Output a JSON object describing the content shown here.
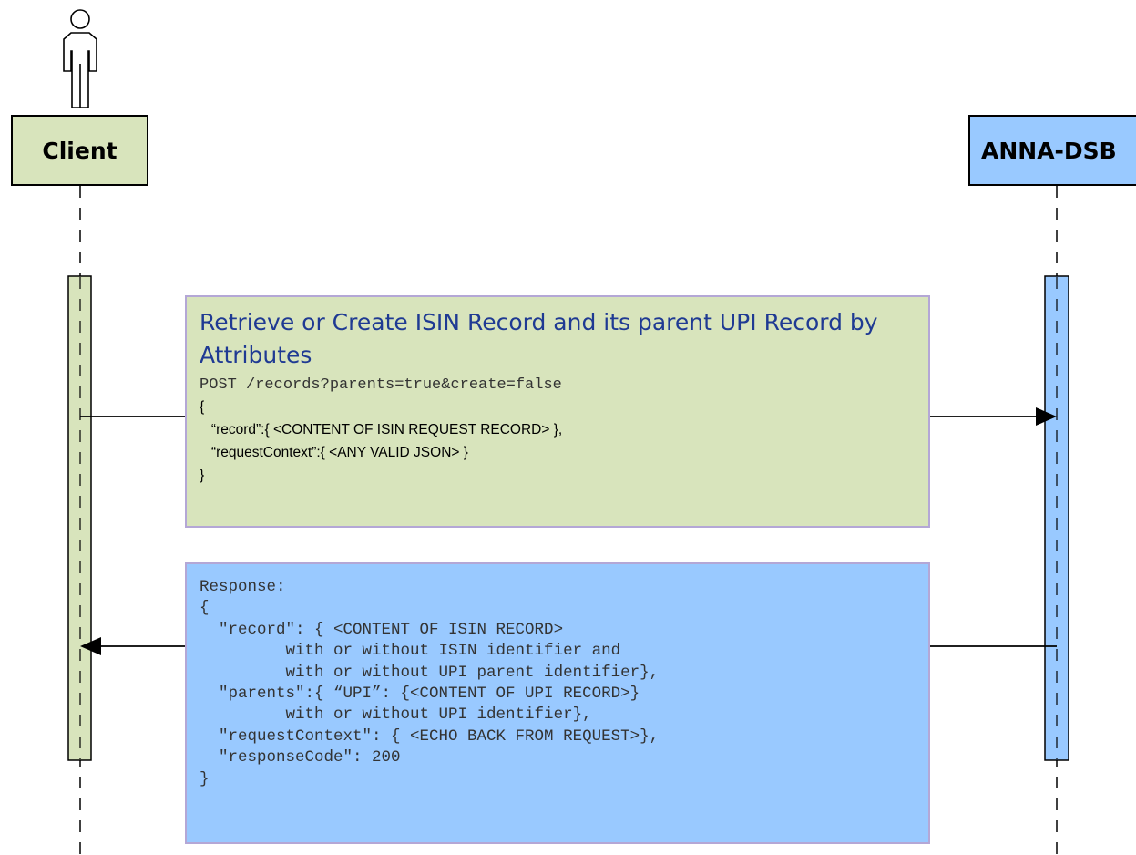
{
  "participants": {
    "client": {
      "label": "Client",
      "color": "#d8e4bc"
    },
    "server": {
      "label": "ANNA-DSB",
      "color": "#99c9ff"
    }
  },
  "request": {
    "title": "Retrieve or Create ISIN Record and its parent UPI Record by Attributes",
    "endpoint": "POST /records?parents=true&create=false",
    "body": [
      "{",
      "   “record”:{ <CONTENT OF ISIN REQUEST RECORD> },",
      "   “requestContext”:{ <ANY VALID JSON> }",
      "}"
    ]
  },
  "response": {
    "lines": [
      "Response:",
      "{",
      "  \"record\": { <CONTENT OF ISIN RECORD>",
      "         with or without ISIN identifier and",
      "         with or without UPI parent identifier},",
      "  \"parents\":{ “UPI”: {<CONTENT OF UPI RECORD>}",
      "         with or without UPI identifier},",
      "  \"requestContext\": { <ECHO BACK FROM REQUEST>},",
      "  \"responseCode\": 200",
      "}"
    ]
  }
}
